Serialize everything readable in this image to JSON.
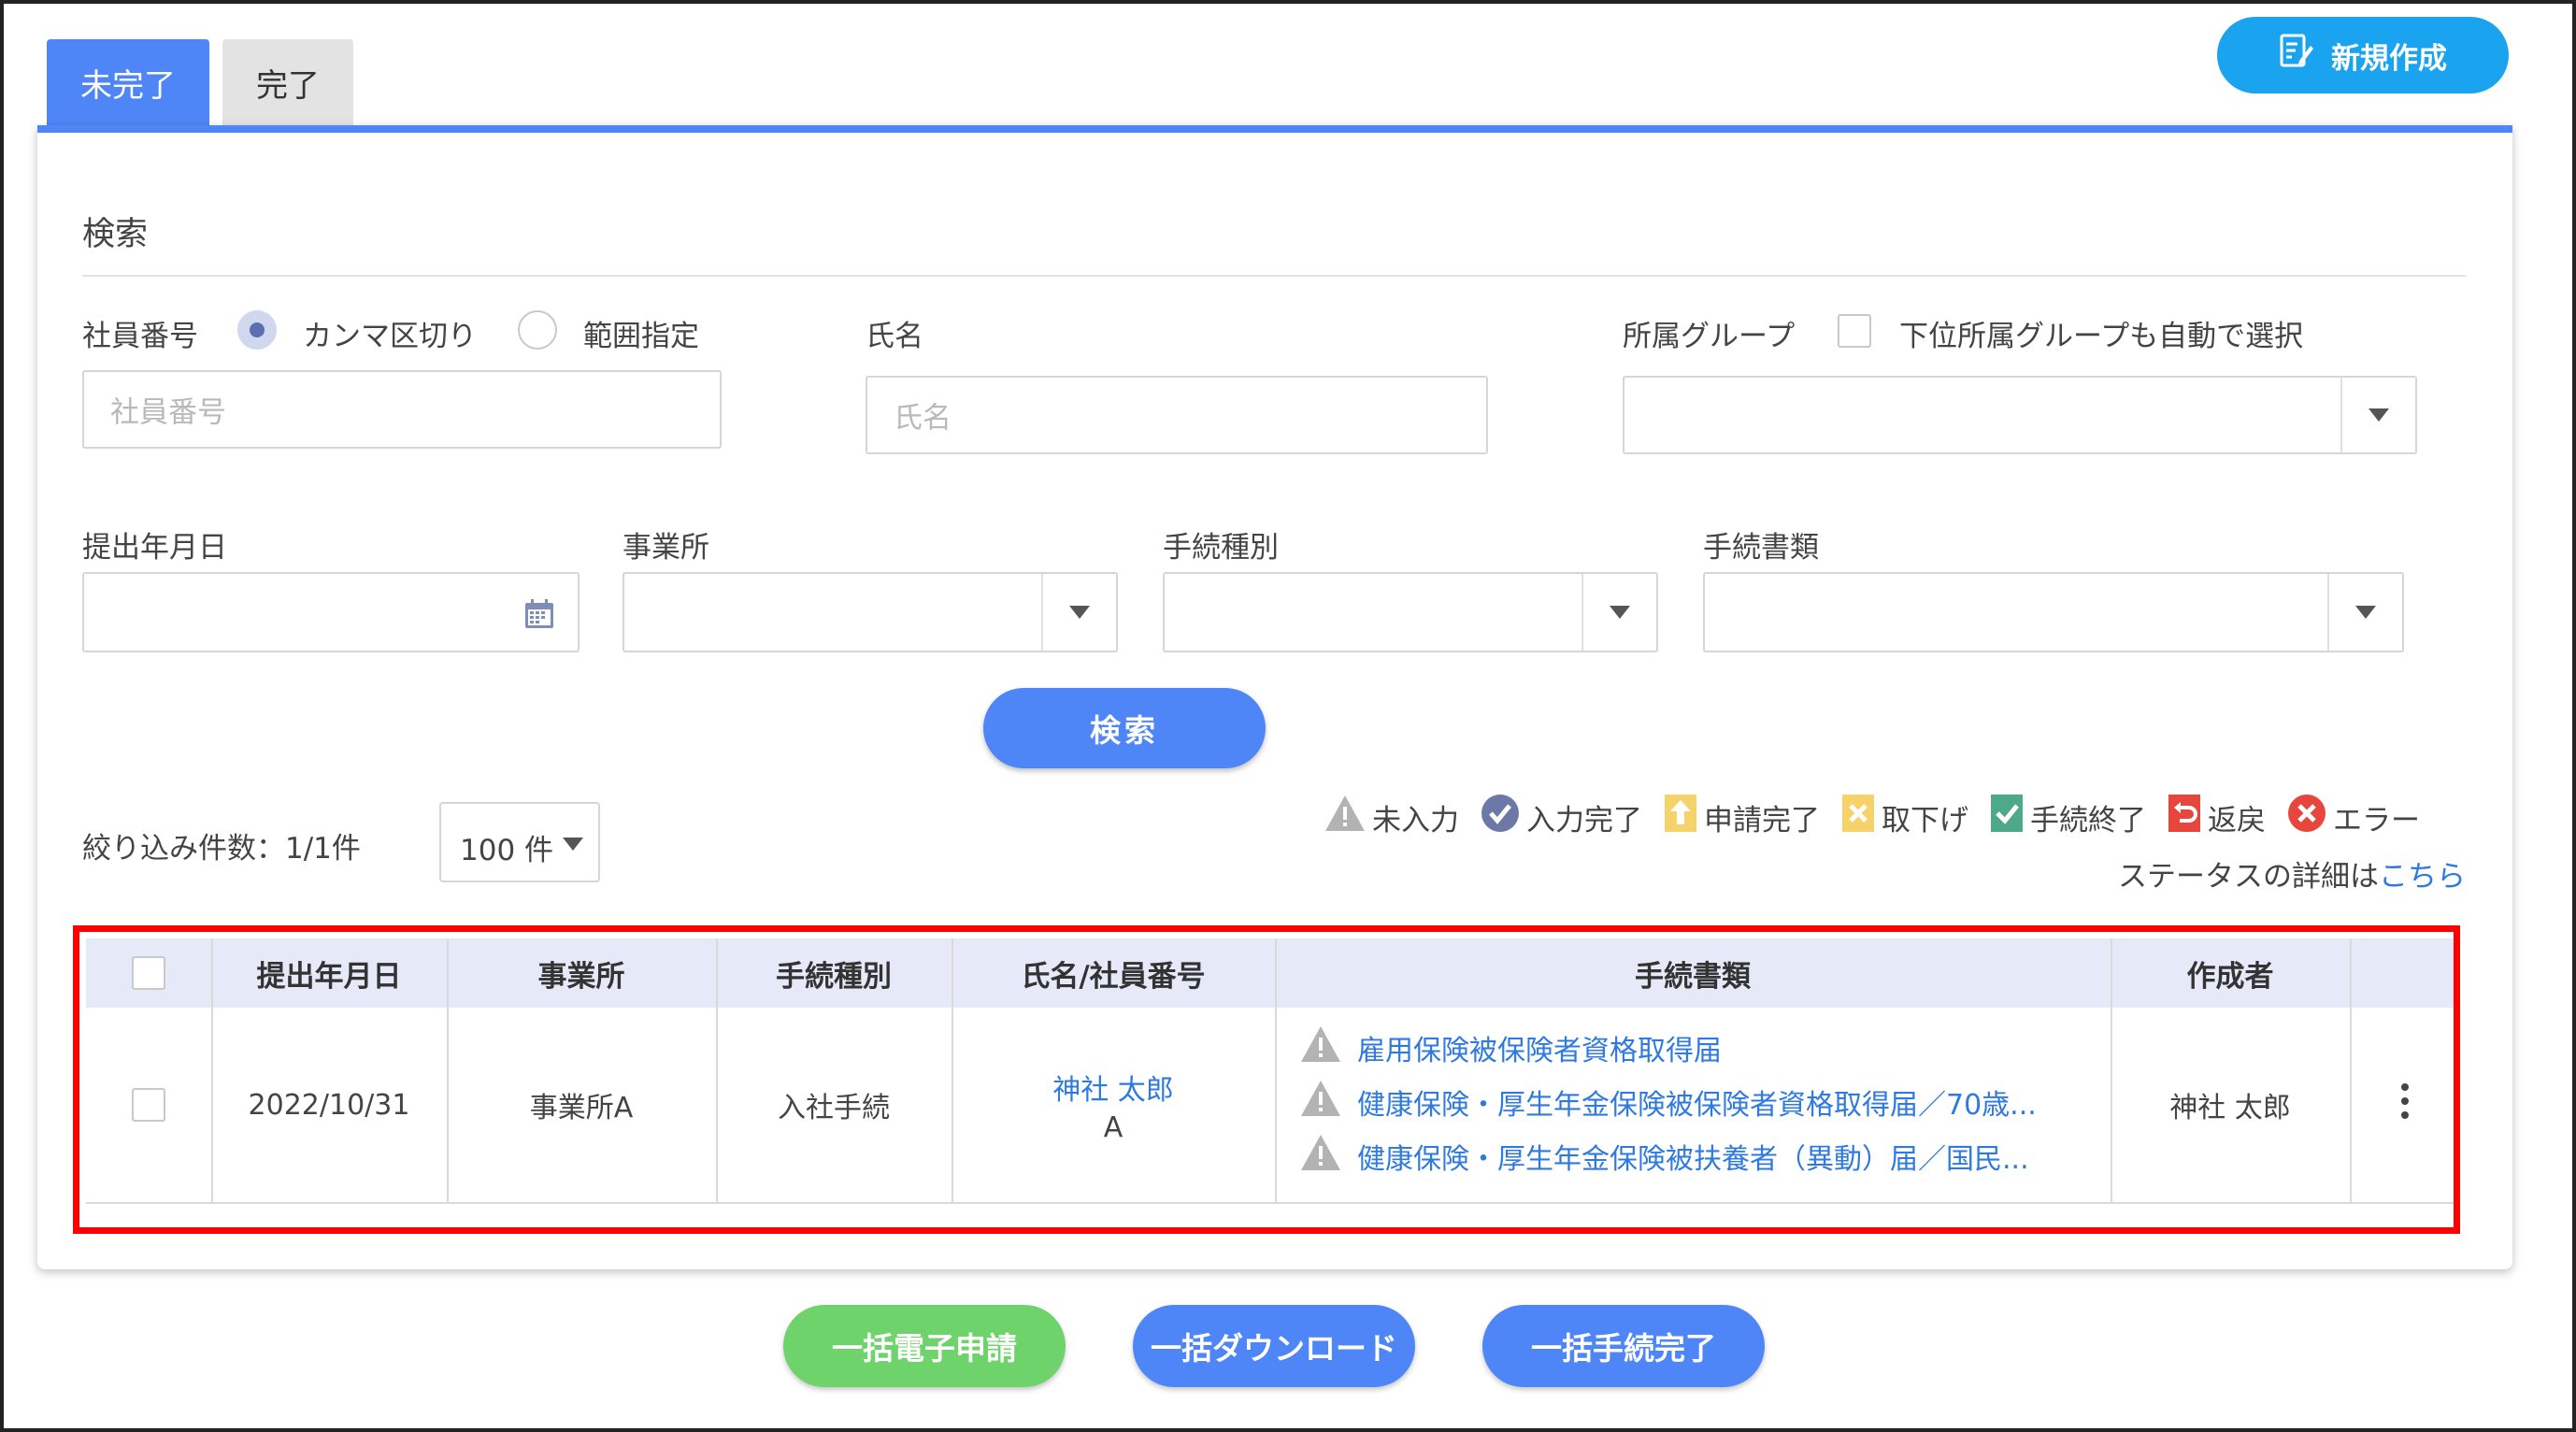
{
  "tabs": [
    {
      "label": "未完了",
      "active": true
    },
    {
      "label": "完了",
      "active": false
    }
  ],
  "new_button": {
    "label": "新規作成",
    "icon": "edit-document-icon"
  },
  "search": {
    "title": "検索",
    "employee_number_label": "社員番号",
    "radio_comma": "カンマ区切り",
    "radio_range": "範囲指定",
    "employee_number_placeholder": "社員番号",
    "name_label": "氏名",
    "name_placeholder": "氏名",
    "group_label": "所属グループ",
    "group_auto_select_label": "下位所属グループも自動で選択",
    "submit_date_label": "提出年月日",
    "office_label": "事業所",
    "procedure_type_label": "手続種別",
    "procedure_doc_label": "手続書類",
    "search_button": "検索"
  },
  "filter": {
    "count_text": "絞り込み件数：1/1件",
    "page_size": "100 件"
  },
  "status_legend": [
    {
      "label": "未入力",
      "icon": "warning-triangle-icon",
      "color": "#b0b0b0"
    },
    {
      "label": "入力完了",
      "icon": "check-circle-icon",
      "color": "#6b78a8"
    },
    {
      "label": "申請完了",
      "icon": "upload-doc-icon",
      "color": "#f3c74a"
    },
    {
      "label": "取下げ",
      "icon": "cancel-doc-icon",
      "color": "#f3c74a"
    },
    {
      "label": "手続終了",
      "icon": "done-doc-icon",
      "color": "#4ea98a"
    },
    {
      "label": "返戻",
      "icon": "return-doc-icon",
      "color": "#e6463c"
    },
    {
      "label": "エラー",
      "icon": "error-circle-icon",
      "color": "#e6463c"
    }
  ],
  "status_detail": {
    "prefix": "ステータスの詳細は",
    "link": "こちら"
  },
  "table": {
    "headers": [
      "提出年月日",
      "事業所",
      "手続種別",
      "氏名/社員番号",
      "手続書類",
      "作成者"
    ],
    "rows": [
      {
        "date": "2022/10/31",
        "office": "事業所A",
        "procedure_type": "入社手続",
        "name": "神社 太郎",
        "employee_no": "A",
        "documents": [
          "雇用保険被保険者資格取得届",
          "健康保険・厚生年金保険被保険者資格取得届／70歳...",
          "健康保険・厚生年金保険被扶養者（異動）届／国民..."
        ],
        "creator": "神社 太郎"
      }
    ]
  },
  "bulk_actions": [
    {
      "label": "一括電子申請",
      "color": "#6fd36b"
    },
    {
      "label": "一括ダウンロード",
      "color": "#4f86f7"
    },
    {
      "label": "一括手続完了",
      "color": "#4f86f7"
    }
  ]
}
